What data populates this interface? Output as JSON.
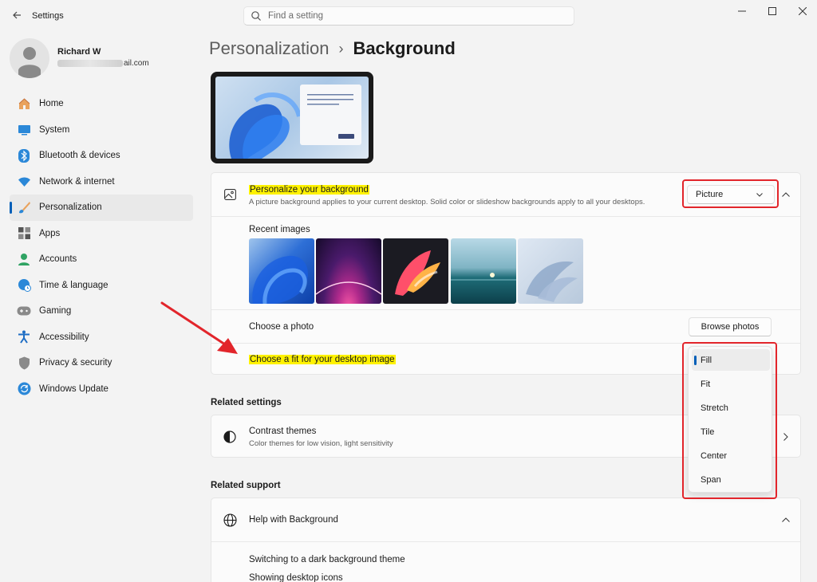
{
  "window": {
    "app_title": "Settings",
    "back_icon": "back-arrow-icon"
  },
  "search": {
    "placeholder": "Find a setting"
  },
  "profile": {
    "name": "Richard W",
    "email_visible": "ail.com"
  },
  "sidebar": {
    "items": [
      {
        "label": "Home",
        "icon": "home-icon"
      },
      {
        "label": "System",
        "icon": "system-icon"
      },
      {
        "label": "Bluetooth & devices",
        "icon": "bluetooth-icon"
      },
      {
        "label": "Network & internet",
        "icon": "network-icon"
      },
      {
        "label": "Personalization",
        "icon": "brush-icon",
        "active": true
      },
      {
        "label": "Apps",
        "icon": "apps-icon"
      },
      {
        "label": "Accounts",
        "icon": "accounts-icon"
      },
      {
        "label": "Time & language",
        "icon": "globe-clock-icon"
      },
      {
        "label": "Gaming",
        "icon": "gamepad-icon"
      },
      {
        "label": "Accessibility",
        "icon": "accessibility-icon"
      },
      {
        "label": "Privacy & security",
        "icon": "shield-icon"
      },
      {
        "label": "Windows Update",
        "icon": "update-icon"
      }
    ]
  },
  "breadcrumb": {
    "parent": "Personalization",
    "separator": "›",
    "current": "Background"
  },
  "background_card": {
    "title": "Personalize your background",
    "subtitle": "A picture background applies to your current desktop. Solid color or slideshow backgrounds apply to all your desktops.",
    "type_value": "Picture",
    "recent_images_label": "Recent images",
    "choose_photo_label": "Choose a photo",
    "browse_button": "Browse photos",
    "fit_label": "Choose a fit for your desktop image"
  },
  "fit_menu": {
    "options": [
      "Fill",
      "Fit",
      "Stretch",
      "Tile",
      "Center",
      "Span"
    ],
    "selected": "Fill"
  },
  "related_settings": {
    "heading": "Related settings",
    "contrast_title": "Contrast themes",
    "contrast_sub": "Color themes for low vision, light sensitivity"
  },
  "related_support": {
    "heading": "Related support",
    "help_title": "Help with Background",
    "links": [
      "Switching to a dark background theme",
      "Showing desktop icons"
    ]
  },
  "colors": {
    "accent": "#005fb8",
    "highlight": "#fff200",
    "annotation": "#e2252b"
  }
}
